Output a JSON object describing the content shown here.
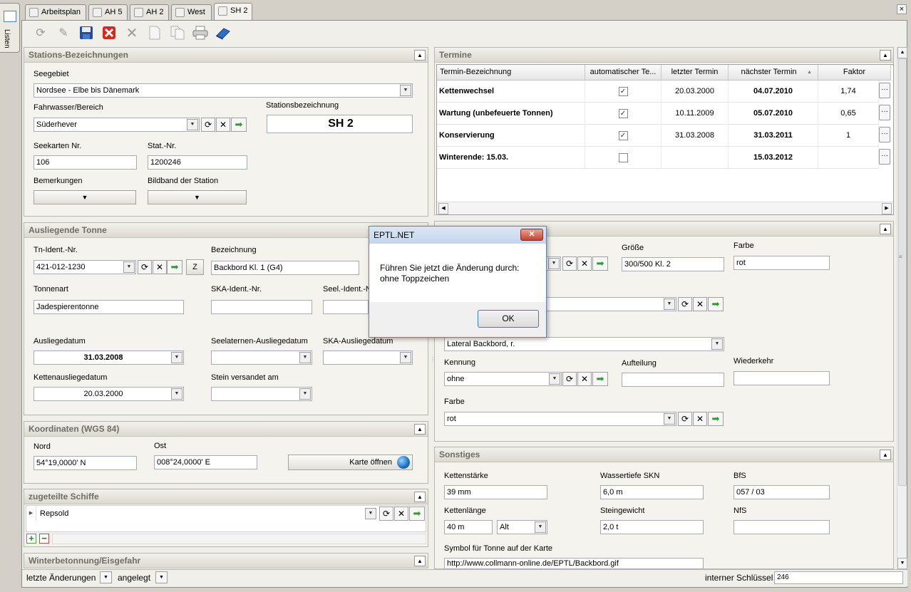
{
  "sidebar": {
    "listen_label": "Listen"
  },
  "tabs": [
    {
      "label": "Arbeitsplan"
    },
    {
      "label": "AH 5"
    },
    {
      "label": "AH 2"
    },
    {
      "label": "West"
    },
    {
      "label": "SH 2"
    }
  ],
  "window": {
    "close_glyph": "×"
  },
  "toolbar": {
    "icons": [
      "refresh-icon",
      "edit-icon",
      "save-icon",
      "delete-icon",
      "cancel-icon",
      "new-icon",
      "copy-icon",
      "print-icon",
      "book-icon"
    ]
  },
  "stations": {
    "title": "Stations-Bezeichnungen",
    "seegebiet_label": "Seegebiet",
    "seegebiet_value": "Nordsee - Elbe bis Dänemark",
    "fahrwasser_label": "Fahrwasser/Bereich",
    "fahrwasser_value": "Süderhever",
    "stationsbez_label": "Stationsbezeichnung",
    "stationsbez_value": "SH 2",
    "seekarten_label": "Seekarten Nr.",
    "seekarten_value": "106",
    "statnr_label": "Stat.-Nr.",
    "statnr_value": "1200246",
    "bemerkungen_label": "Bemerkungen",
    "bildband_label": "Bildband der Station"
  },
  "tonne": {
    "title": "Ausliegende Tonne",
    "tnident_label": "Tn-Ident.-Nr.",
    "tnident_value": "421-012-1230",
    "z_label": "Z",
    "bezeichnung_label": "Bezeichnung",
    "bezeichnung_value": "Backbord Kl. 1 (G4)",
    "tonnenart_label": "Tonnenart",
    "tonnenart_value": "Jadespierentonne",
    "skaident_label": "SKA-Ident.-Nr.",
    "seelident_label": "Seel.-Ident.-Nr.",
    "ausliege_label": "Ausliegedatum",
    "ausliege_value": "31.03.2008",
    "seelaternen_label": "Seelaternen-Ausliegedatum",
    "skaausliege_label": "SKA-Ausliegedatum",
    "ketten_label": "Kettenausliegedatum",
    "ketten_value": "20.03.2000",
    "stein_label": "Stein versandet am"
  },
  "koordinaten": {
    "title": "Koordinaten (WGS 84)",
    "nord_label": "Nord",
    "nord_value": "54°19,0000' N",
    "ost_label": "Ost",
    "ost_value": "008°24,0000' E",
    "karte_label": "Karte öffnen"
  },
  "schiffe": {
    "title": "zugeteilte Schiffe",
    "row_value": "Repsold"
  },
  "winter": {
    "title": "Winterbetonnung/Eisgefahr"
  },
  "termine": {
    "title": "Termine",
    "columns": [
      "Termin-Bezeichnung",
      "automatischer Te...",
      "letzter Termin",
      "nächster Termin",
      "Faktor"
    ],
    "rows": [
      {
        "name": "Kettenwechsel",
        "auto": "✓",
        "last": "20.03.2000",
        "next": "04.07.2010",
        "factor": "1,74"
      },
      {
        "name": "Wartung (unbefeuerte Tonnen)",
        "auto": "✓",
        "last": "10.11.2009",
        "next": "05.07.2010",
        "factor": "0,65"
      },
      {
        "name": "Konservierung",
        "auto": "✓",
        "last": "31.03.2008",
        "next": "31.03.2011",
        "factor": "1"
      },
      {
        "name": "Winterende: 15.03.",
        "auto": "",
        "last": "",
        "next": "15.03.2012",
        "factor": ""
      }
    ],
    "dots_glyph": "···"
  },
  "merkmale": {
    "groesse_label": "Größe",
    "groesse_value": "300/500  Kl. 2",
    "farbe1_label": "Farbe",
    "farbe1_value": "rot",
    "lateral_value": "Lateral Backbord, r.",
    "kennung_label": "Kennung",
    "kennung_value": "ohne",
    "aufteilung_label": "Aufteilung",
    "wiederkehr_label": "Wiederkehr",
    "farbe2_label": "Farbe",
    "farbe2_value": "rot"
  },
  "sonstiges": {
    "title": "Sonstiges",
    "kettenstaerke_label": "Kettenstärke",
    "kettenstaerke_value": "39 mm",
    "wassertiefe_label": "Wassertiefe SKN",
    "wassertiefe_value": "6,0 m",
    "bfs_label": "BfS",
    "bfs_value": "057 / 03",
    "kettenlaenge_label": "Kettenlänge",
    "kettenlaenge_value": "40 m",
    "alt_value": "Alt",
    "steingewicht_label": "Steingewicht",
    "steingewicht_value": "2,0 t",
    "nfs_label": "NfS",
    "symbol_label": "Symbol für Tonne auf der Karte",
    "symbol_value": "http://www.collmann-online.de/EPTL/Backbord.gif"
  },
  "status": {
    "letzte_label": "letzte Änderungen",
    "angelegt_label": "angelegt",
    "schluessel_label": "interner Schlüssel",
    "schluessel_value": "246"
  },
  "dialog": {
    "title": "EPTL.NET",
    "close_glyph": "✕",
    "line1": "Führen Sie jetzt die Änderung durch:",
    "line2": "ohne Toppzeichen",
    "ok_label": "OK"
  }
}
